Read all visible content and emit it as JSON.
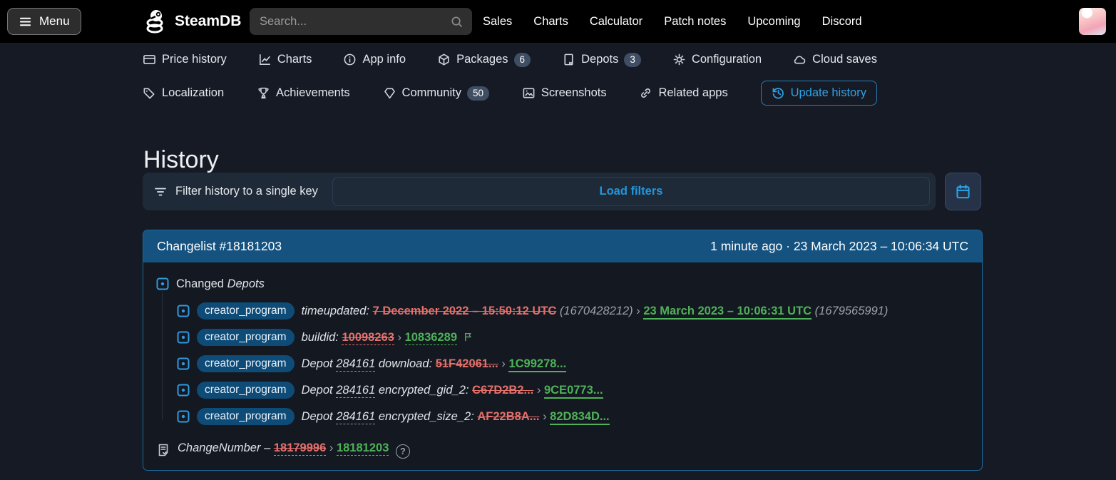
{
  "navbar": {
    "menu_label": "Menu",
    "brand": "SteamDB",
    "search_placeholder": "Search...",
    "links": [
      "Sales",
      "Charts",
      "Calculator",
      "Patch notes",
      "Upcoming",
      "Discord"
    ]
  },
  "tabs": {
    "row1": [
      {
        "label": "Price history"
      },
      {
        "label": "Charts"
      },
      {
        "label": "App info"
      },
      {
        "label": "Packages",
        "badge": "6"
      },
      {
        "label": "Depots",
        "badge": "3"
      },
      {
        "label": "Configuration"
      },
      {
        "label": "Cloud saves"
      }
    ],
    "row2": [
      {
        "label": "Localization"
      },
      {
        "label": "Achievements"
      },
      {
        "label": "Community",
        "badge": "50"
      },
      {
        "label": "Screenshots"
      },
      {
        "label": "Related apps"
      },
      {
        "label": "Update history"
      }
    ]
  },
  "page": {
    "title": "History"
  },
  "filter": {
    "label": "Filter history to a single key",
    "load_button": "Load filters"
  },
  "changelist": {
    "title": "Changelist #18181203",
    "timestamp": "1 minute ago · 23 March 2023 – 10:06:34 UTC",
    "group_prefix": "Changed",
    "group_name": "Depots",
    "sep": "›",
    "rows": [
      {
        "app": "creator_program",
        "key": "timeupdated:",
        "old": "7 December 2022 – 15:50:12 UTC",
        "old_note": "(1670428212)",
        "new": "23 March 2023 – 10:06:31 UTC",
        "new_note": "(1679565991)"
      },
      {
        "app": "creator_program",
        "key": "buildid:",
        "old": "10098263",
        "new": "10836289"
      },
      {
        "app": "creator_program",
        "key_pre": "Depot",
        "key_num": "284161",
        "key": "download:",
        "old": "51F42061...",
        "new": "1C99278..."
      },
      {
        "app": "creator_program",
        "key_pre": "Depot",
        "key_num": "284161",
        "key": "encrypted_gid_2:",
        "old": "C67D2B2...",
        "new": "9CE0773..."
      },
      {
        "app": "creator_program",
        "key_pre": "Depot",
        "key_num": "284161",
        "key": "encrypted_size_2:",
        "old": "AF22B8A...",
        "new": "82D834D..."
      }
    ],
    "footer": {
      "label": "ChangeNumber –",
      "old": "18179996",
      "new": "18181203",
      "help": "?"
    }
  },
  "colors": {
    "accent_blue": "#2fa2e6",
    "header_blue": "#15527f",
    "added_green": "#4eb258",
    "removed_red": "#e4706b"
  }
}
